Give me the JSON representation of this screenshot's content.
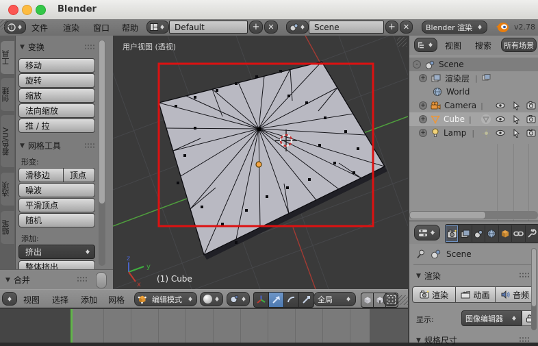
{
  "glyphs": {
    "tri": "▼",
    "plus": "+",
    "minus": "-",
    "close": "✕",
    "pipe": "|",
    "add": "+"
  },
  "window": {
    "title": "Blender"
  },
  "topbar": {
    "menus": [
      "文件",
      "渲染",
      "窗口",
      "帮助"
    ],
    "layout_value": "Default",
    "scene_value": "Scene",
    "engine_value": "Blender 渲染",
    "version": "v2.78"
  },
  "shelf": {
    "tabs": [
      {
        "label": "工具"
      },
      {
        "label": "创建"
      },
      {
        "label": "着色/UV"
      },
      {
        "label": "选项"
      },
      {
        "label": "蜡笔"
      }
    ],
    "transform": {
      "title": "变换",
      "buttons": [
        "移动",
        "旋转",
        "缩放",
        "法向缩放",
        "推 / 拉"
      ]
    },
    "mesh": {
      "title": "网格工具",
      "deform_label": "形变:",
      "slide_edge": "滑移边",
      "vertex": "顶点",
      "buttons": [
        "噪波",
        "平滑顶点",
        "随机"
      ],
      "add_label": "添加:",
      "extrude_value": "挤出",
      "extrude_all": "整体挤出"
    },
    "merge_title": "合并"
  },
  "viewport": {
    "label": "用户视图 (透视)",
    "object_label": "(1) Cube",
    "axes": {
      "x": "x",
      "y": "y",
      "z": "z"
    }
  },
  "v3d": {
    "menus": [
      "视图",
      "选择",
      "添加",
      "网格"
    ],
    "mode_value": "编辑模式",
    "orientation_value": "全局"
  },
  "outliner": {
    "menus": [
      "视图",
      "搜索"
    ],
    "filter_value": "所有场景",
    "rows": [
      {
        "name": "Scene"
      },
      {
        "name": "渲染层"
      },
      {
        "name": "World"
      },
      {
        "name": "Camera"
      },
      {
        "name": "Cube"
      },
      {
        "name": "Lamp"
      }
    ]
  },
  "props": {
    "scene_name": "Scene",
    "render_title": "渲染",
    "buttons": [
      "渲染",
      "动画",
      "音频"
    ],
    "display_label": "显示:",
    "display_value": "图像编辑器",
    "dimensions_title": "规格尺寸"
  }
}
